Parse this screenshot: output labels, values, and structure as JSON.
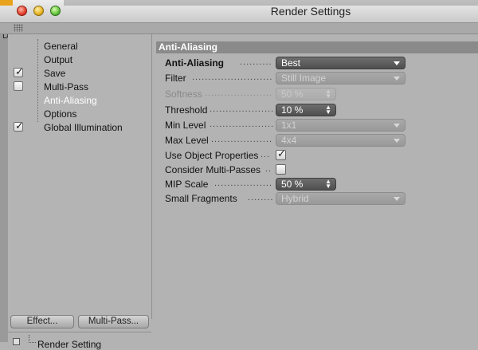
{
  "window": {
    "title": "Render Settings",
    "edge_letter": "D",
    "icons": {
      "close": "close-dot-icon",
      "minimize": "minimize-dot-icon",
      "zoom": "zoom-dot-icon",
      "grip": "grip-icon"
    }
  },
  "nav": {
    "items": [
      {
        "label": "General",
        "has_checkbox": false,
        "checked": false,
        "active": false
      },
      {
        "label": "Output",
        "has_checkbox": false,
        "checked": false,
        "active": false
      },
      {
        "label": "Save",
        "has_checkbox": true,
        "checked": true,
        "active": false
      },
      {
        "label": "Multi-Pass",
        "has_checkbox": true,
        "checked": false,
        "active": false
      },
      {
        "label": "Anti-Aliasing",
        "has_checkbox": false,
        "checked": false,
        "active": true
      },
      {
        "label": "Options",
        "has_checkbox": false,
        "checked": false,
        "active": false
      },
      {
        "label": "Global Illumination",
        "has_checkbox": true,
        "checked": true,
        "active": false
      }
    ],
    "check_mark": "✓"
  },
  "buttons": {
    "effect": "Effect...",
    "multipass": "Multi-Pass..."
  },
  "bottom": {
    "render_setting_label": "Render Setting"
  },
  "section": {
    "header": "Anti-Aliasing",
    "rows": {
      "anti_aliasing": {
        "label": "Anti-Aliasing",
        "value": "Best"
      },
      "filter": {
        "label": "Filter",
        "value": "Still Image"
      },
      "softness": {
        "label": "Softness",
        "value": "50 %"
      },
      "threshold": {
        "label": "Threshold",
        "value": "10 %"
      },
      "min_level": {
        "label": "Min Level",
        "value": "1x1"
      },
      "max_level": {
        "label": "Max Level",
        "value": "4x4"
      },
      "use_object_properties": {
        "label": "Use Object Properties",
        "checked": true
      },
      "consider_multi_passes": {
        "label": "Consider Multi-Passes",
        "checked": false
      },
      "mip_scale": {
        "label": "MIP Scale",
        "value": "50 %"
      },
      "small_fragments": {
        "label": "Small Fragments",
        "value": "Hybrid"
      }
    }
  },
  "colors": {
    "panel_bg": "#b3b3b3",
    "section_header_bg": "#8a8a8a",
    "active_control_bg": "#5f5f5f",
    "title_bar": "#dcdcdc"
  }
}
